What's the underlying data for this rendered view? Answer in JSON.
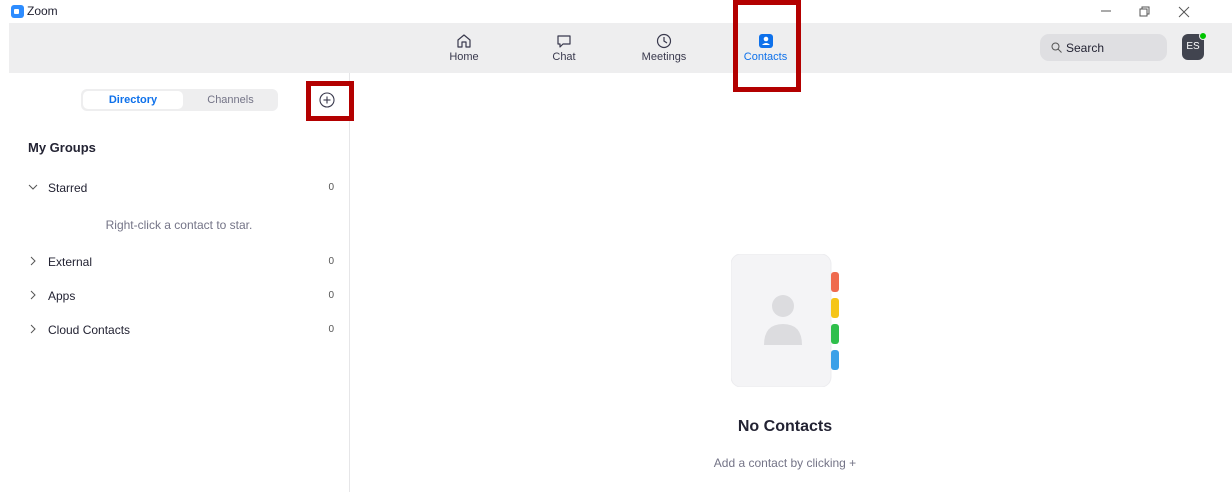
{
  "window": {
    "title": "Zoom",
    "minimize_label": "—",
    "restore_label": "❐",
    "close_label": "✕"
  },
  "nav": {
    "items": [
      {
        "label": "Home",
        "icon": "home-icon"
      },
      {
        "label": "Chat",
        "icon": "chat-icon"
      },
      {
        "label": "Meetings",
        "icon": "clock-icon"
      },
      {
        "label": "Contacts",
        "icon": "contacts-icon"
      }
    ],
    "active": "Contacts",
    "search_placeholder": "Search",
    "avatar_initials": "ES"
  },
  "sidebar": {
    "tabs": [
      "Directory",
      "Channels"
    ],
    "active_tab": "Directory",
    "add_icon": "plus-circle-icon",
    "section_title": "My Groups",
    "groups": [
      {
        "label": "Starred",
        "count": "0",
        "expanded": true
      },
      {
        "label": "External",
        "count": "0",
        "expanded": false
      },
      {
        "label": "Apps",
        "count": "0",
        "expanded": false
      },
      {
        "label": "Cloud Contacts",
        "count": "0",
        "expanded": false
      }
    ],
    "starred_hint": "Right-click a contact to star."
  },
  "main": {
    "empty_title": "No Contacts",
    "empty_subtitle": "Add a contact by clicking +"
  },
  "colors": {
    "accent": "#0e71eb",
    "highlight": "#b30000",
    "tab_red": "#ef6a4e",
    "tab_yellow": "#f5c518",
    "tab_green": "#2fbf4b",
    "tab_blue": "#3aa0e8"
  }
}
